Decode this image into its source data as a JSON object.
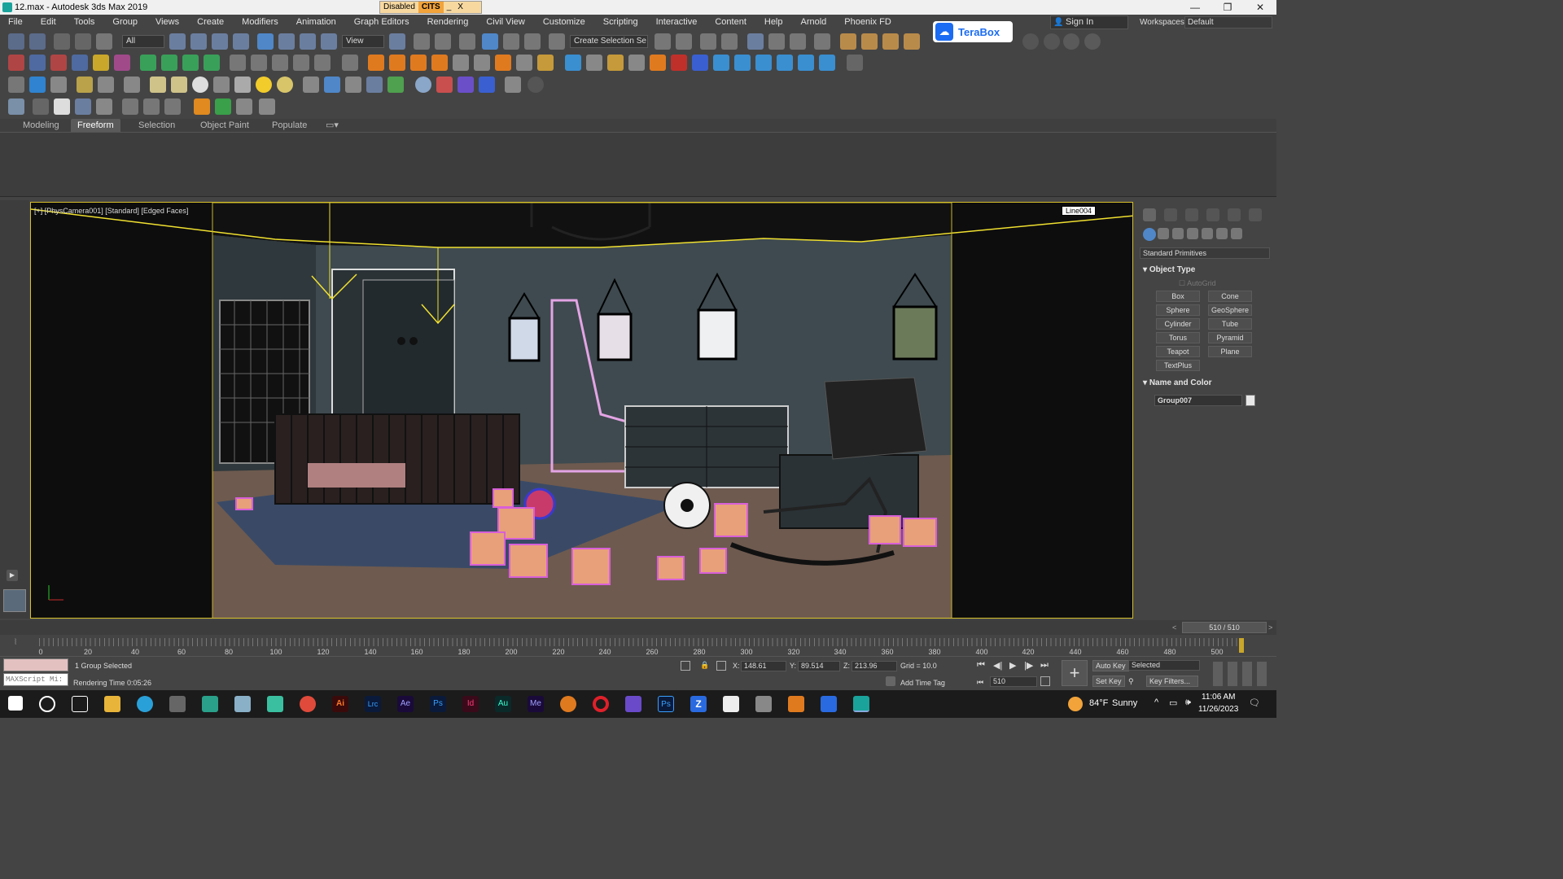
{
  "window": {
    "title": "12.max - Autodesk 3ds Max 2019",
    "disabled_label": "Disabled",
    "cits_label": "CITS",
    "min": "—",
    "max": "❐",
    "close": "✕"
  },
  "menu": [
    "File",
    "Edit",
    "Tools",
    "Group",
    "Views",
    "Create",
    "Modifiers",
    "Animation",
    "Graph Editors",
    "Rendering",
    "Civil View",
    "Customize",
    "Scripting",
    "Interactive",
    "Content",
    "Help",
    "Arnold",
    "Phoenix FD"
  ],
  "signin": "Sign In",
  "workspaces": {
    "label": "Workspaces:",
    "value": "Default"
  },
  "toolbar": {
    "filter": "All",
    "refcoord": "View",
    "selset": "Create Selection Se"
  },
  "terabox": "TeraBox",
  "ribbon": {
    "tabs": [
      "Modeling",
      "Freeform",
      "Selection",
      "Object Paint",
      "Populate"
    ],
    "active": "Freeform"
  },
  "viewport": {
    "label": "[+] [PhysCamera001] [Standard] [Edged Faces]",
    "selected_object_label": "Line004"
  },
  "command_panel": {
    "dropdown": "Standard Primitives",
    "object_type_title": "Object Type",
    "autogrid": "AutoGrid",
    "buttons": [
      "Box",
      "Cone",
      "Sphere",
      "GeoSphere",
      "Cylinder",
      "Tube",
      "Torus",
      "Pyramid",
      "Teapot",
      "Plane",
      "TextPlus"
    ],
    "name_color_title": "Name and Color",
    "object_name": "Group007"
  },
  "timeline": {
    "frame": "510 / 510",
    "ticks": [
      "0",
      "20",
      "40",
      "60",
      "80",
      "100",
      "120",
      "140",
      "160",
      "180",
      "200",
      "220",
      "240",
      "260",
      "280",
      "300",
      "320",
      "340",
      "360",
      "380",
      "400",
      "420",
      "440",
      "460",
      "480",
      "500"
    ]
  },
  "status": {
    "maxscript": "MAXScript Mi:",
    "selection": "1 Group Selected",
    "render_time": "Rendering Time  0:05:26",
    "x_label": "X:",
    "x": "148.61",
    "y_label": "Y:",
    "y": "89.514",
    "z_label": "Z:",
    "z": "213.96",
    "grid": "Grid = 10.0",
    "add_time_tag": "Add Time Tag",
    "auto_key": "Auto Key",
    "set_key": "Set Key",
    "key_mode": "Selected",
    "key_filters": "Key Filters...",
    "frame_field": "510"
  },
  "taskbar": {
    "weather_temp": "84°F",
    "weather_text": "Sunny",
    "time": "11:06 AM",
    "date": "11/26/2023"
  }
}
